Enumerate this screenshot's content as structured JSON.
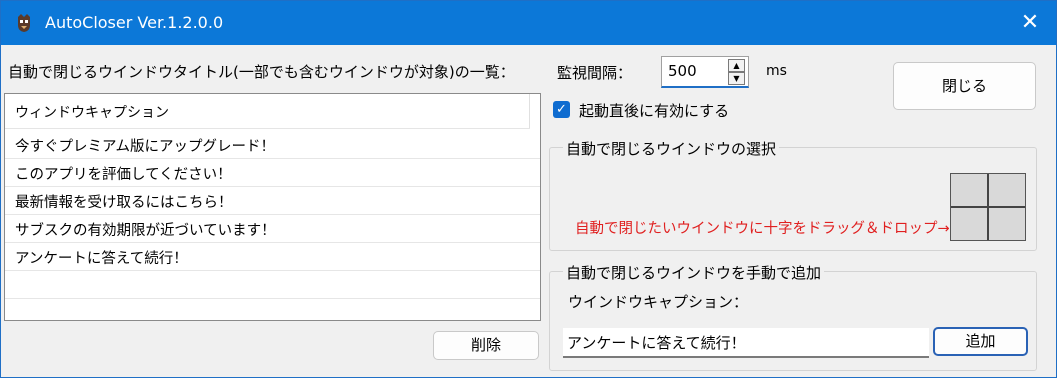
{
  "window": {
    "title": "AutoCloser Ver.1.2.0.0",
    "close_glyph": "✕"
  },
  "list_section": {
    "label": "自動で閉じるウインドウタイトル(一部でも含むウインドウが対象)の一覧：",
    "column_header": "ウィンドウキャプション",
    "items": [
      "今すぐプレミアム版にアップグレード！",
      "このアプリを評価してください！",
      "最新情報を受け取るにはこちら！",
      "サブスクの有効期限が近づいています！",
      "アンケートに答えて続行！"
    ],
    "delete_button": "削除"
  },
  "interval": {
    "label": "監視間隔：",
    "value": "500",
    "unit": "ms",
    "up_glyph": "▲",
    "down_glyph": "▼"
  },
  "close_button": "閉じる",
  "startup_checkbox": {
    "label": "起動直後に有効にする",
    "checked": true,
    "check_glyph": "✓"
  },
  "select_group": {
    "title": "自動で閉じるウインドウの選択",
    "instruction": "自動で閉じたいウインドウに十字をドラッグ＆ドロップ→"
  },
  "manual_group": {
    "title": "自動で閉じるウインドウを手動で追加",
    "caption_label": "ウインドウキャプション：",
    "caption_value": "アンケートに答えて続行！",
    "add_button": "追加"
  },
  "colors": {
    "titlebar": "#0c78d8",
    "accent": "#0f6cd0",
    "instruction_text": "#e02020"
  }
}
